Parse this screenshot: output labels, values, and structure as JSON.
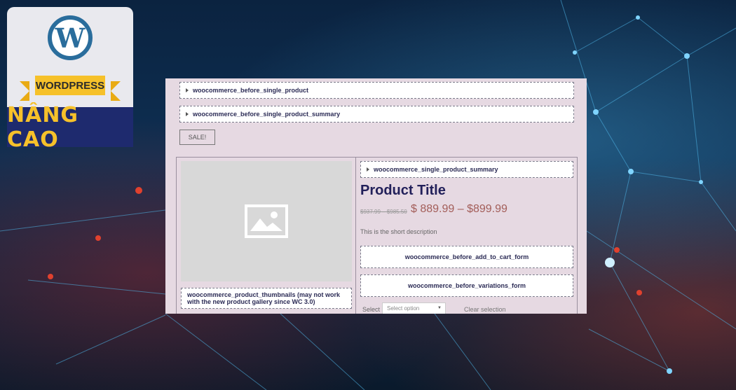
{
  "logo": {
    "wp_letter": "W",
    "ribbon_text": "WORDPRESS",
    "bottom_text": "NÂNG CAO",
    "colors": {
      "blue": "#2a6d9c",
      "yellow": "#f6c12a",
      "navy": "#1e2a6e"
    }
  },
  "panel": {
    "hook_before_single_product": "woocommerce_before_single_product",
    "hook_before_summary": "woocommerce_before_single_product_summary",
    "sale_badge": "SALE!",
    "hook_single_summary": "woocommerce_single_product_summary",
    "product_title": "Product Title",
    "price_old": "$937.99 – $985.50",
    "price_new": "$ 889.99 – $899.99",
    "short_description": "This is the short description",
    "hook_before_add_to_cart": "woocommerce_before_add_to_cart_form",
    "hook_before_variations": "woocommerce_before_variations_form",
    "thumbnails_hook": "woocommerce_product_thumbnails (may not work with the new product gallery since WC 3.0)",
    "select_label": "Select",
    "select_placeholder": "Select option",
    "clear_selection": "Clear selection"
  }
}
